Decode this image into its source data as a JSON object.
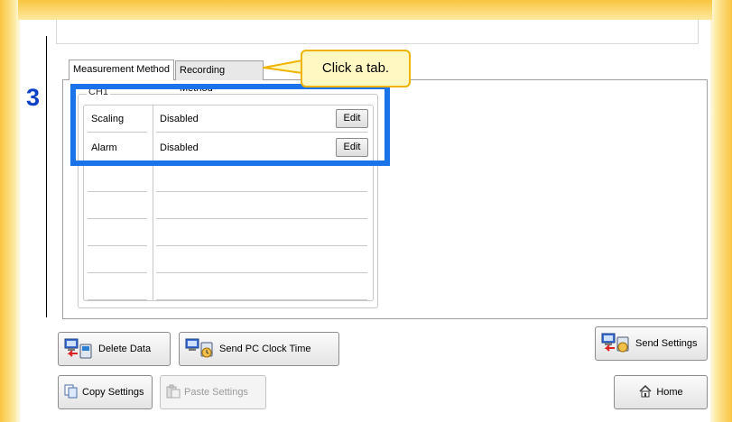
{
  "callout": {
    "text": "Click a tab."
  },
  "step": {
    "number": "3"
  },
  "tabs": [
    {
      "label": "Measurement Method",
      "active": true
    },
    {
      "label": "Recording Method",
      "active": false
    }
  ],
  "group": {
    "label": "CH1",
    "rows": [
      {
        "name": "Scaling",
        "value": "Disabled",
        "button": "Edit"
      },
      {
        "name": "Alarm",
        "value": "Disabled",
        "button": "Edit"
      }
    ]
  },
  "buttons": {
    "delete_data": "Delete Data",
    "send_pc_clock": "Send PC Clock Time",
    "send_settings": "Send Settings",
    "copy_settings": "Copy Settings",
    "paste_settings": "Paste Settings",
    "home": "Home"
  },
  "colors": {
    "highlight": "#1a73e8",
    "step_number": "#0a3fc8",
    "callout_border": "#f0b400",
    "frame": "#f9c53f"
  },
  "icons": {
    "delete_data": "pc-logger-transfer-icon",
    "send_pc_clock": "pc-clock-transfer-icon",
    "send_settings": "pc-logger-transfer-icon",
    "copy_settings": "copy-icon",
    "paste_settings": "paste-icon",
    "home": "home-icon"
  }
}
